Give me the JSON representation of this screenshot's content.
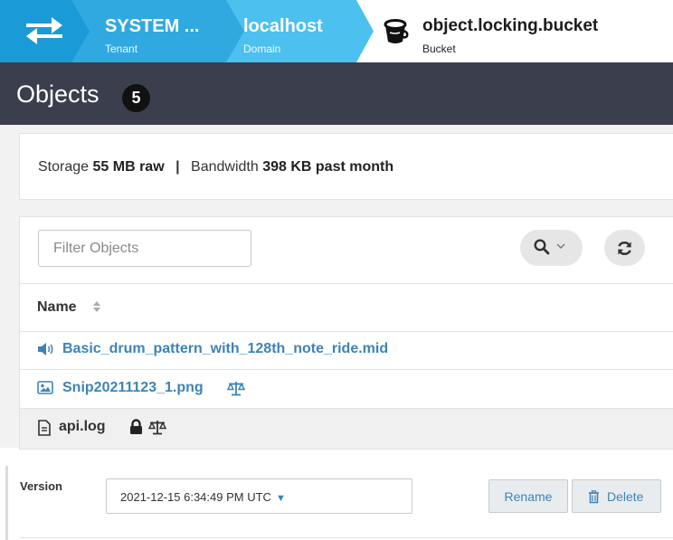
{
  "breadcrumb": {
    "tenant": {
      "name": "SYSTEM ...",
      "type": "Tenant"
    },
    "domain": {
      "name": "localhost",
      "type": "Domain"
    },
    "bucket": {
      "name": "object.locking.bucket",
      "type": "Bucket"
    }
  },
  "page": {
    "title": "Objects",
    "count": "5"
  },
  "stats": {
    "storage_label": "Storage",
    "storage_value": "55 MB raw",
    "separator": "|",
    "bandwidth_label": "Bandwidth",
    "bandwidth_value": "398 KB past month"
  },
  "toolbar": {
    "filter_placeholder": "Filter Objects"
  },
  "table": {
    "column_name": "Name"
  },
  "objects": [
    {
      "name": "Basic_drum_pattern_with_128th_note_ride.mid",
      "icon": "audio-icon"
    },
    {
      "name": "Snip20211123_1.png",
      "icon": "image-icon",
      "badges": [
        "scale-icon"
      ]
    },
    {
      "name": "api.log",
      "icon": "document-icon",
      "badges": [
        "lock-icon",
        "scale-icon"
      ]
    }
  ],
  "version": {
    "label": "Version",
    "selected": "2021-12-15 6:34:49 PM UTC",
    "rename_label": "Rename",
    "delete_label": "Delete"
  },
  "colors": {
    "accent": "#1a9bd7",
    "link": "#3d83b5",
    "titlebar": "#3b3e4d"
  }
}
